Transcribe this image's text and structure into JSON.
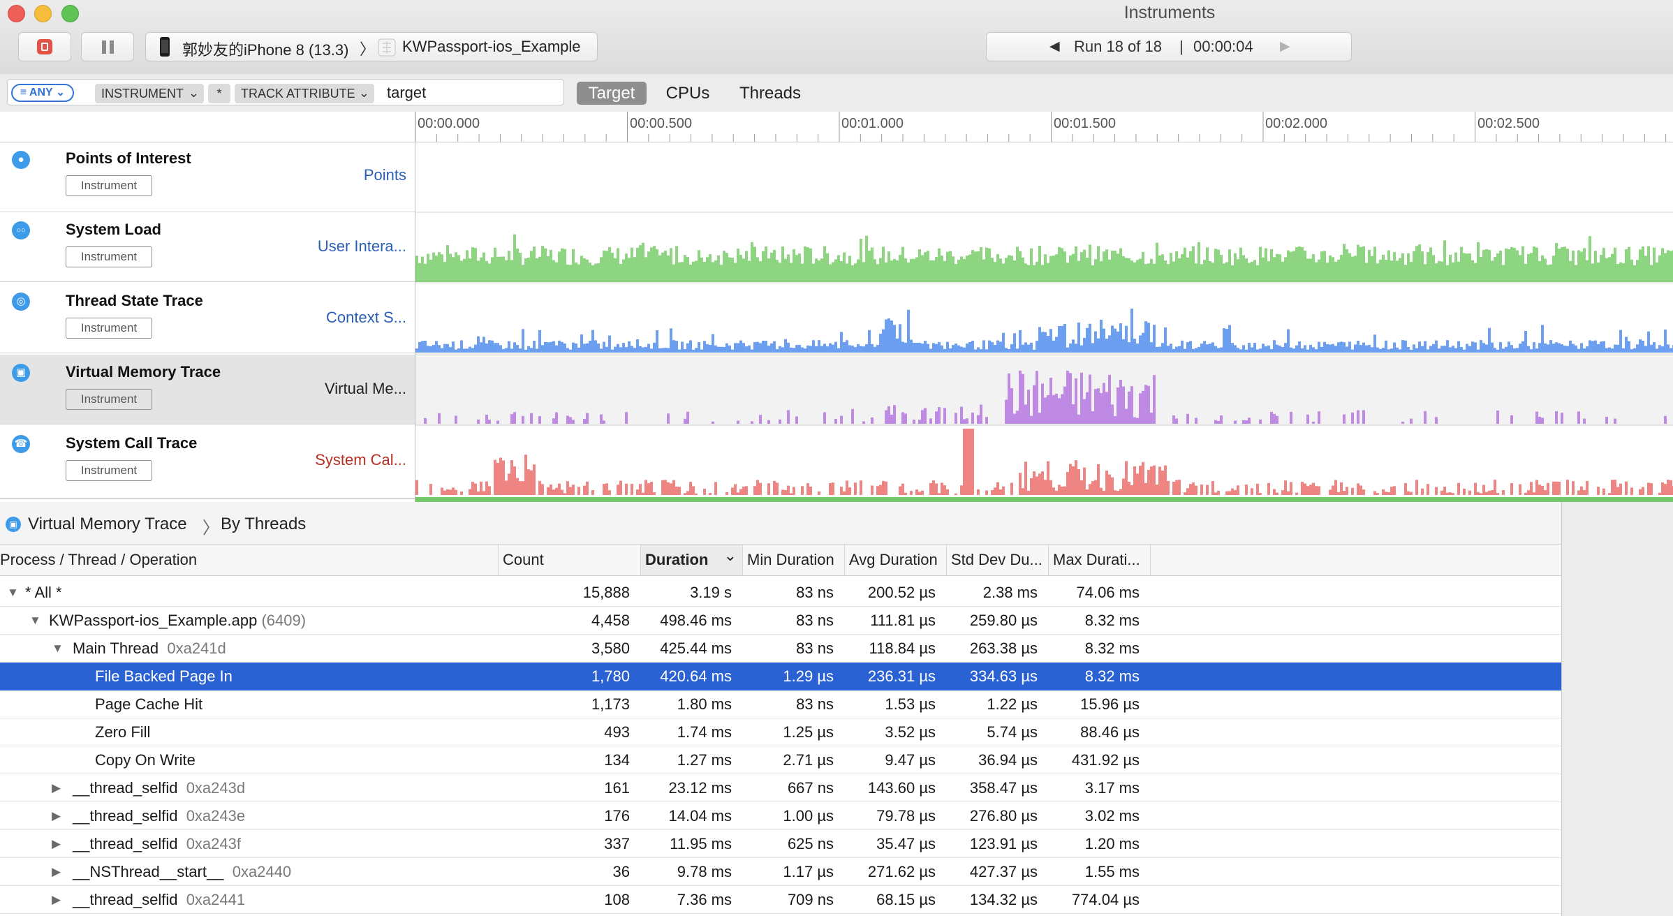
{
  "window": {
    "title": "Instruments"
  },
  "toolbar": {
    "device_label": "郭妙友的iPhone 8 (13.3)",
    "separator": "〉",
    "target_label": "KWPassport-ios_Example",
    "run_label": "Run 18 of 18",
    "run_divider": "|",
    "run_time": "00:00:04"
  },
  "filter": {
    "any_label": "ANY",
    "instrument_token": "INSTRUMENT",
    "star_token": "*",
    "track_attr_token": "TRACK ATTRIBUTE",
    "search_value": "target",
    "scopes": [
      "Target",
      "CPUs",
      "Threads"
    ]
  },
  "ruler": {
    "ticks": [
      "00:00.000",
      "00:00.500",
      "00:01.000",
      "00:01.500",
      "00:02.000",
      "00:02.500"
    ]
  },
  "tracks": [
    {
      "name": "Points of Interest",
      "tag": "Instrument",
      "mode": "Points",
      "mode_color": "#2a5fb8",
      "color": "#3d9be9"
    },
    {
      "name": "System Load",
      "tag": "Instrument",
      "mode": "User Intera...",
      "mode_color": "#2a5fb8",
      "color": "#8ed581"
    },
    {
      "name": "Thread State Trace",
      "tag": "Instrument",
      "mode": "Context S...",
      "mode_color": "#2a5fb8",
      "color": "#6d9ff1"
    },
    {
      "name": "Virtual Memory Trace",
      "tag": "Instrument",
      "mode": "Virtual Me...",
      "mode_color": "#222222",
      "color": "#be8ae3"
    },
    {
      "name": "System Call Trace",
      "tag": "Instrument",
      "mode": "System Cal...",
      "mode_color": "#b52e22",
      "color": "#ee8582"
    }
  ],
  "detail": {
    "breadcrumb_instrument": "Virtual Memory Trace",
    "breadcrumb_sep": "〉",
    "breadcrumb_view": "By Threads"
  },
  "columns": [
    "Process / Thread / Operation",
    "Count",
    "Duration",
    "Min Duration",
    "Avg Duration",
    "Std Dev Du...",
    "Max Durati..."
  ],
  "sort_indicator": "⌄",
  "rows": [
    {
      "name": "* All *",
      "suffix": "",
      "count": "15,888",
      "duration": "3.19 s",
      "min": "83 ns",
      "avg": "200.52 µs",
      "std": "2.38 ms",
      "max": "74.06 ms",
      "expanded": true,
      "indent": 0
    },
    {
      "name": "KWPassport-ios_Example.app",
      "suffix": "(6409)",
      "count": "4,458",
      "duration": "498.46 ms",
      "min": "83 ns",
      "avg": "111.81 µs",
      "std": "259.80 µs",
      "max": "8.32 ms",
      "expanded": true,
      "indent": 1
    },
    {
      "name": "Main Thread",
      "suffix": "0xa241d",
      "count": "3,580",
      "duration": "425.44 ms",
      "min": "83 ns",
      "avg": "118.84 µs",
      "std": "263.38 µs",
      "max": "8.32 ms",
      "expanded": true,
      "indent": 2
    },
    {
      "name": "File Backed Page In",
      "suffix": "",
      "count": "1,780",
      "duration": "420.64 ms",
      "min": "1.29 µs",
      "avg": "236.31 µs",
      "std": "334.63 µs",
      "max": "8.32 ms",
      "selected": true,
      "indent": 3
    },
    {
      "name": "Page Cache Hit",
      "suffix": "",
      "count": "1,173",
      "duration": "1.80 ms",
      "min": "83 ns",
      "avg": "1.53 µs",
      "std": "1.22 µs",
      "max": "15.96 µs",
      "indent": 3
    },
    {
      "name": "Zero Fill",
      "suffix": "",
      "count": "493",
      "duration": "1.74 ms",
      "min": "1.25 µs",
      "avg": "3.52 µs",
      "std": "5.74 µs",
      "max": "88.46 µs",
      "indent": 3
    },
    {
      "name": "Copy On Write",
      "suffix": "",
      "count": "134",
      "duration": "1.27 ms",
      "min": "2.71 µs",
      "avg": "9.47 µs",
      "std": "36.94 µs",
      "max": "431.92 µs",
      "indent": 3
    },
    {
      "name": "__thread_selfid",
      "suffix": "0xa243d",
      "count": "161",
      "duration": "23.12 ms",
      "min": "667 ns",
      "avg": "143.60 µs",
      "std": "358.47 µs",
      "max": "3.17 ms",
      "collapsed": true,
      "indent": 2
    },
    {
      "name": "__thread_selfid",
      "suffix": "0xa243e",
      "count": "176",
      "duration": "14.04 ms",
      "min": "1.00 µs",
      "avg": "79.78 µs",
      "std": "276.80 µs",
      "max": "3.02 ms",
      "collapsed": true,
      "indent": 2
    },
    {
      "name": "__thread_selfid",
      "suffix": "0xa243f",
      "count": "337",
      "duration": "11.95 ms",
      "min": "625 ns",
      "avg": "35.47 µs",
      "std": "123.91 µs",
      "max": "1.20 ms",
      "collapsed": true,
      "indent": 2
    },
    {
      "name": "__NSThread__start__",
      "suffix": "0xa2440",
      "count": "36",
      "duration": "9.78 ms",
      "min": "1.17 µs",
      "avg": "271.62 µs",
      "std": "427.37 µs",
      "max": "1.55 ms",
      "collapsed": true,
      "indent": 2
    },
    {
      "name": "__thread_selfid",
      "suffix": "0xa2441",
      "count": "108",
      "duration": "7.36 ms",
      "min": "709 ns",
      "avg": "68.15 µs",
      "std": "134.32 µs",
      "max": "774.04 µs",
      "collapsed": true,
      "indent": 2
    }
  ]
}
